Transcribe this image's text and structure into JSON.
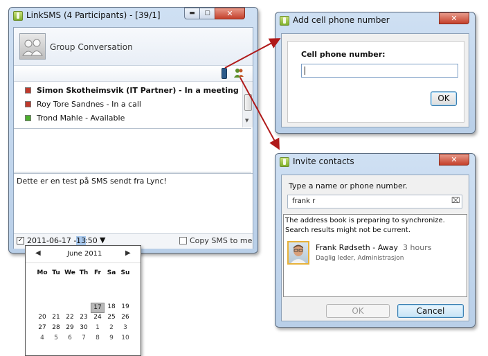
{
  "main_window": {
    "title": "LinkSMS (4 Participants) - [39/1]",
    "conversation_label": "Group Conversation",
    "participants": [
      {
        "name": "Simon Skotheimsvik (IT Partner) - In a meeting",
        "status": "busy",
        "bold": true
      },
      {
        "name": "Roy Tore Sandnes - In a call",
        "status": "busy",
        "bold": false
      },
      {
        "name": "Trond Mahle - Available",
        "status": "available",
        "bold": false
      }
    ],
    "message_text": "Dette er en test på SMS sendt fra Lync!",
    "schedule_date": "2011-06-17 - ",
    "schedule_hour": "13",
    "schedule_minute": ":50",
    "copy_sms_label": "Copy SMS to me"
  },
  "calendar": {
    "month_label": "June 2011",
    "weekdays": [
      "Mo",
      "Tu",
      "We",
      "Th",
      "Fr",
      "Sa",
      "Su"
    ],
    "weeks": [
      [
        "",
        "",
        "",
        "",
        "",
        "",
        ""
      ],
      [
        "",
        "",
        "",
        "",
        "",
        "",
        ""
      ],
      [
        "",
        "",
        "",
        "",
        "17",
        "18",
        "19"
      ],
      [
        "20",
        "21",
        "22",
        "23",
        "24",
        "25",
        "26"
      ],
      [
        "27",
        "28",
        "29",
        "30",
        "1",
        "2",
        "3"
      ],
      [
        "4",
        "5",
        "6",
        "7",
        "8",
        "9",
        "10"
      ]
    ],
    "selected_day": "17"
  },
  "add_cell_dialog": {
    "title": "Add cell phone number",
    "field_label": "Cell phone number:",
    "field_value": "",
    "ok_label": "OK"
  },
  "invite_dialog": {
    "title": "Invite contacts",
    "prompt": "Type a name or phone number.",
    "search_value": "frank r",
    "notice_line1": "The address book is preparing to synchronize.",
    "notice_line2": "Search results might not be current.",
    "contact": {
      "name": "Frank Rødseth - Away",
      "away_time": "3 hours",
      "title": "Daglig leder, Administrasjon"
    },
    "ok_label": "OK",
    "cancel_label": "Cancel"
  },
  "colors": {
    "busy": "#c0392b",
    "available": "#4caf2c",
    "arrow": "#b01a1a",
    "selected_day_bg": "#b8b8b8"
  }
}
